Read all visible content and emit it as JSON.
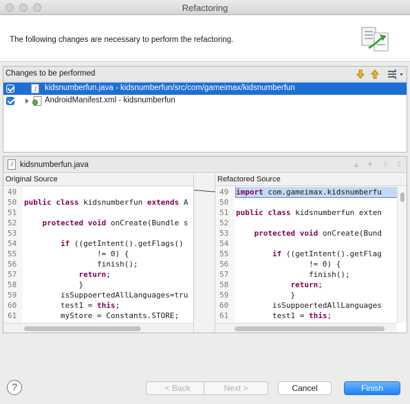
{
  "window": {
    "title": "Refactoring"
  },
  "header": {
    "message": "The following changes are necessary to perform the refactoring."
  },
  "changes": {
    "title": "Changes to be performed",
    "items": [
      {
        "label": "kidsnumberfun.java - kidsnumberfun/src/com/gameimax/kidsnumberfun",
        "checked": true,
        "selected": true
      },
      {
        "label": "AndroidManifest.xml - kidsnumberfun",
        "checked": true,
        "selected": false
      }
    ]
  },
  "compare": {
    "file": "kidsnumberfun.java",
    "original_title": "Original Source",
    "refactored_title": "Refactored Source",
    "original_lines": [
      {
        "n": "49",
        "t": ""
      },
      {
        "n": "50",
        "t": "public class kidsnumberfun extends A"
      },
      {
        "n": "51",
        "t": ""
      },
      {
        "n": "52",
        "t": "    protected void onCreate(Bundle s"
      },
      {
        "n": "53",
        "t": ""
      },
      {
        "n": "54",
        "t": "        if ((getIntent().getFlags()"
      },
      {
        "n": "55",
        "t": "                != 0) {"
      },
      {
        "n": "56",
        "t": "                finish();"
      },
      {
        "n": "57",
        "t": "            return;"
      },
      {
        "n": "58",
        "t": "            }"
      },
      {
        "n": "59",
        "t": "        isSuppoertedAllLanguages=tru"
      },
      {
        "n": "60",
        "t": "        test1 = this;"
      },
      {
        "n": "61",
        "t": "        myStore = Constants.STORE;"
      }
    ],
    "refactored_lines": [
      {
        "n": "49",
        "t": "import com.gameimax.kidsnumberfu"
      },
      {
        "n": "50",
        "t": ""
      },
      {
        "n": "51",
        "t": "public class kidsnumberfun exten"
      },
      {
        "n": "52",
        "t": ""
      },
      {
        "n": "53",
        "t": "    protected void onCreate(Bund"
      },
      {
        "n": "54",
        "t": ""
      },
      {
        "n": "55",
        "t": "        if ((getIntent().getFlag"
      },
      {
        "n": "56",
        "t": "                != 0) {"
      },
      {
        "n": "57",
        "t": "                finish();"
      },
      {
        "n": "58",
        "t": "            return;"
      },
      {
        "n": "59",
        "t": "            }"
      },
      {
        "n": "60",
        "t": "        isSuppoertedAllLanguages"
      },
      {
        "n": "61",
        "t": "        test1 = this;"
      }
    ]
  },
  "footer": {
    "help": "?",
    "back": "< Back",
    "next": "Next >",
    "cancel": "Cancel",
    "finish": "Finish"
  },
  "colors": {
    "selection": "#1f6ed6",
    "primary_button": "#1a82fb",
    "keyword": "#7f0055"
  }
}
